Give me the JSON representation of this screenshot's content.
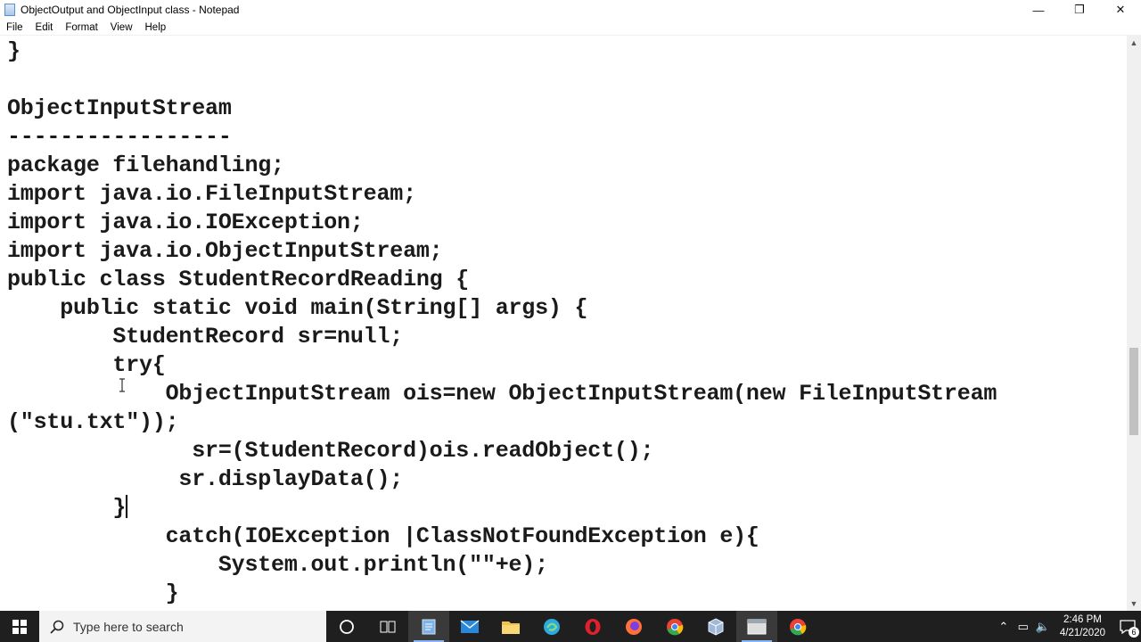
{
  "window": {
    "title": "ObjectOutput and ObjectInput class - Notepad",
    "minimize_glyph": "—",
    "restore_glyph": "❐",
    "close_glyph": "✕"
  },
  "menu": [
    "File",
    "Edit",
    "Format",
    "View",
    "Help"
  ],
  "editor": {
    "lines": [
      "}",
      "",
      "ObjectInputStream",
      "-----------------",
      "package filehandling;",
      "import java.io.FileInputStream;",
      "import java.io.IOException;",
      "import java.io.ObjectInputStream;",
      "public class StudentRecordReading {",
      "    public static void main(String[] args) {",
      "        StudentRecord sr=null;",
      "        try{",
      "            ObjectInputStream ois=new ObjectInputStream(new FileInputStream",
      "(\"stu.txt\"));",
      "              sr=(StudentRecord)ois.readObject();",
      "             sr.displayData();",
      "        }",
      "            catch(IOException |ClassNotFoundException e){",
      "                System.out.println(\"\"+e);",
      "            }"
    ]
  },
  "taskbar": {
    "search_placeholder": "Type here to search",
    "apps": [
      {
        "name": "cortana-icon",
        "color": "#ffffff"
      },
      {
        "name": "task-view-icon",
        "color": "#ffffff"
      },
      {
        "name": "notepad-icon",
        "color": "#7fb2e5"
      },
      {
        "name": "mail-icon",
        "color": "#2b88d8"
      },
      {
        "name": "file-explorer-icon",
        "color": "#f2c14e"
      },
      {
        "name": "edge-icon",
        "color": "#2ea8e0"
      },
      {
        "name": "opera-icon",
        "color": "#e0202b"
      },
      {
        "name": "firefox-icon",
        "color": "#ff7139"
      },
      {
        "name": "chrome-icon",
        "color": "#34a853"
      },
      {
        "name": "virtualbox-icon",
        "color": "#9fb8d8"
      },
      {
        "name": "app-window-icon",
        "color": "#dddddd"
      },
      {
        "name": "chrome-icon-2",
        "color": "#34a853"
      }
    ],
    "time": "2:46 PM",
    "date": "4/21/2020",
    "notification_count": "6"
  }
}
